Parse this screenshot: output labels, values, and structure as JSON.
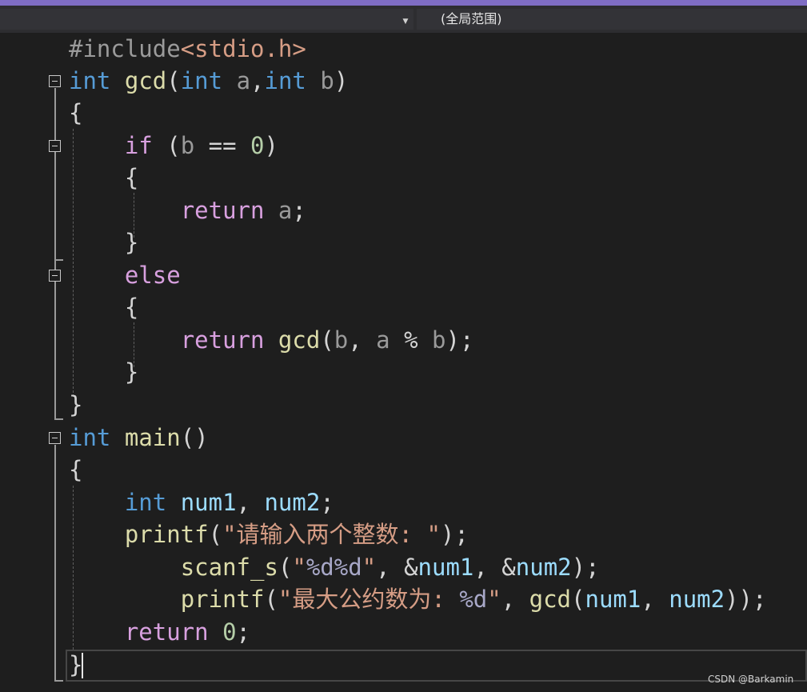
{
  "navbar": {
    "scope_dropdown_value": "",
    "scope_label": "(全局范围)"
  },
  "code": {
    "l1": [
      "#include",
      "<stdio.h>"
    ],
    "l2": [
      "int",
      " ",
      "gcd",
      "(",
      "int",
      " ",
      "a",
      ",",
      "int",
      " ",
      "b",
      ")"
    ],
    "l3": [
      "{"
    ],
    "l4": [
      "    ",
      "if",
      " ",
      "(",
      "b",
      " == ",
      "0",
      ")"
    ],
    "l5": [
      "    ",
      "{"
    ],
    "l6": [
      "        ",
      "return",
      " ",
      "a",
      ";"
    ],
    "l7": [
      "    ",
      "}"
    ],
    "l8": [
      "    ",
      "else"
    ],
    "l9": [
      "    ",
      "{"
    ],
    "l10": [
      "        ",
      "return",
      " ",
      "gcd",
      "(",
      "b",
      ", ",
      "a",
      " % ",
      "b",
      ");"
    ],
    "l11": [
      "    ",
      "}"
    ],
    "l12": [
      "}"
    ],
    "l13": [
      "int",
      " ",
      "main",
      "()"
    ],
    "l14": [
      "{"
    ],
    "l15": [
      "    ",
      "int",
      " ",
      "num1",
      ", ",
      "num2",
      ";"
    ],
    "l16": [
      "    ",
      "printf",
      "(",
      "\"请输入两个整数: \"",
      ");"
    ],
    "l17": [
      "        ",
      "scanf_s",
      "(",
      "\"",
      "%d%d",
      "\"",
      ", &",
      "num1",
      ", &",
      "num2",
      ");"
    ],
    "l18": [
      "        ",
      "printf",
      "(",
      "\"最大公约数为: ",
      "%d",
      "\"",
      ", ",
      "gcd",
      "(",
      "num1",
      ", ",
      "num2",
      "));"
    ],
    "l19": [
      "    ",
      "return",
      " ",
      "0",
      ";"
    ],
    "l20": [
      "}"
    ]
  },
  "watermark": "CSDN @Barkamin",
  "colors": {
    "keyword": "#569cd6",
    "control": "#d8a0df",
    "function": "#dcdcaa",
    "variable": "#9cdcfe",
    "parameter": "#9a9a9a",
    "string": "#d69d85",
    "number": "#b5cea8",
    "background": "#1e1e1e"
  }
}
